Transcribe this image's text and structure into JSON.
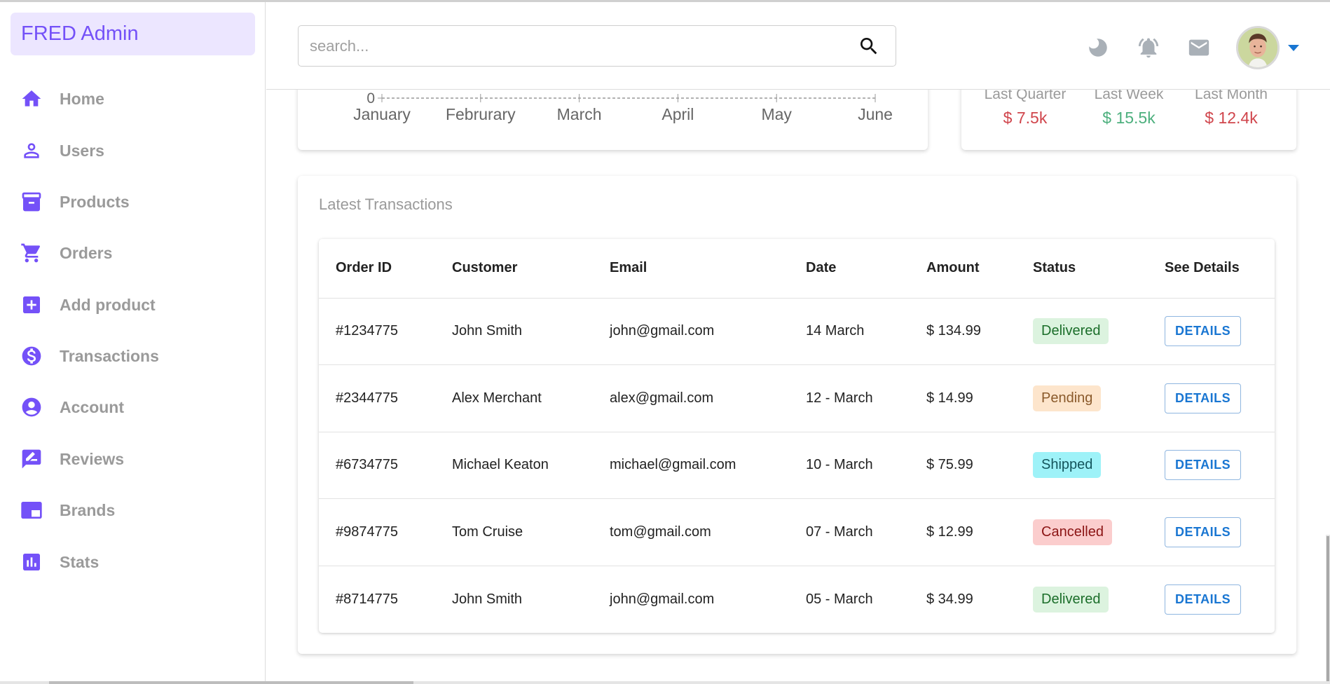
{
  "app": {
    "title": "FRED Admin"
  },
  "sidebar": {
    "items": [
      {
        "label": "Home",
        "icon": "home-icon"
      },
      {
        "label": "Users",
        "icon": "person-icon"
      },
      {
        "label": "Products",
        "icon": "archive-box-icon"
      },
      {
        "label": "Orders",
        "icon": "shopping-cart-icon"
      },
      {
        "label": "Add product",
        "icon": "add-box-icon"
      },
      {
        "label": "Transactions",
        "icon": "dollar-circle-icon"
      },
      {
        "label": "Account",
        "icon": "account-circle-icon"
      },
      {
        "label": "Reviews",
        "icon": "rate-review-icon"
      },
      {
        "label": "Brands",
        "icon": "picture-in-picture-icon"
      },
      {
        "label": "Stats",
        "icon": "bar-chart-icon"
      }
    ]
  },
  "header": {
    "search": {
      "placeholder": "search...",
      "value": ""
    },
    "icons": [
      "dark-mode-icon",
      "notifications-icon",
      "mail-icon"
    ],
    "avatar_alt": "user avatar"
  },
  "colors": {
    "accent": "#7451f8",
    "brand_bg": "#ece6ff",
    "negative": "#d0454c",
    "positive": "#4caf7d",
    "link_blue": "#1976d2"
  },
  "chart_data": {
    "type": "line",
    "title": "",
    "categories": [
      "January",
      "Februrary",
      "March",
      "April",
      "May",
      "June"
    ],
    "visible_y_ticks": [
      "0"
    ],
    "xlabel": "",
    "ylabel": "",
    "grid": "dashed horizontal",
    "note": "chart scrolled out of view; only the x-axis baseline at 0 is visible"
  },
  "stats": [
    {
      "label": "Last Quarter",
      "value": "$ 7.5k",
      "trend": "negative"
    },
    {
      "label": "Last Week",
      "value": "$ 15.5k",
      "trend": "positive"
    },
    {
      "label": "Last Month",
      "value": "$ 12.4k",
      "trend": "negative"
    }
  ],
  "transactions": {
    "title": "Latest Transactions",
    "columns": [
      "Order ID",
      "Customer",
      "Email",
      "Date",
      "Amount",
      "Status",
      "See Details"
    ],
    "rows": [
      {
        "id": "#1234775",
        "customer": "John Smith",
        "email": "john@gmail.com",
        "date": "14 March",
        "amount": "$ 134.99",
        "status": "Delivered",
        "action": "DETAILS"
      },
      {
        "id": "#2344775",
        "customer": "Alex Merchant",
        "email": "alex@gmail.com",
        "date": "12 - March",
        "amount": "$ 14.99",
        "status": "Pending",
        "action": "DETAILS"
      },
      {
        "id": "#6734775",
        "customer": "Michael Keaton",
        "email": "michael@gmail.com",
        "date": "10 - March",
        "amount": "$ 75.99",
        "status": "Shipped",
        "action": "DETAILS"
      },
      {
        "id": "#9874775",
        "customer": "Tom Cruise",
        "email": "tom@gmail.com",
        "date": "07 - March",
        "amount": "$ 12.99",
        "status": "Cancelled",
        "action": "DETAILS"
      },
      {
        "id": "#8714775",
        "customer": "John Smith",
        "email": "john@gmail.com",
        "date": "05 - March",
        "amount": "$ 34.99",
        "status": "Delivered",
        "action": "DETAILS"
      }
    ],
    "status_styles": {
      "Delivered": {
        "bg": "#dcf3df",
        "fg": "#1b6e2a"
      },
      "Pending": {
        "bg": "#fde5cc",
        "fg": "#8a5a2b"
      },
      "Shipped": {
        "bg": "#9ef2f8",
        "fg": "#14555c"
      },
      "Cancelled": {
        "bg": "#fbcdcd",
        "fg": "#8b1414"
      }
    }
  }
}
